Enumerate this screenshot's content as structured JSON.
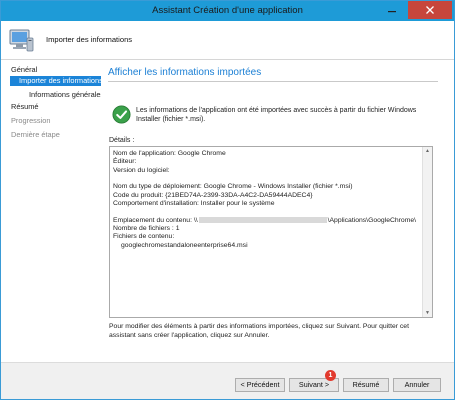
{
  "window": {
    "title": "Assistant Création d'une application"
  },
  "header": {
    "title": "Importer des informations"
  },
  "sidebar": {
    "items": [
      {
        "label": "Général"
      },
      {
        "label": "Importer des informations"
      },
      {
        "label": "Informations générales"
      },
      {
        "label": "Résumé"
      },
      {
        "label": "Progression"
      },
      {
        "label": "Dernière étape"
      }
    ]
  },
  "main": {
    "title": "Afficher les informations importées",
    "info_text": "Les informations de l'application ont été importées avec succès à partir du fichier Windows Installer (fichier *.msi).",
    "details_label": "Détails :",
    "details": {
      "line1": "Nom de l'application: Google Chrome",
      "line2": "Éditeur:",
      "line3": "Version du logiciel:",
      "line4": "Nom du type de déploiement: Google Chrome - Windows Installer (fichier *.msi)",
      "line5": "Code du produit: {21BED74A-2399-33DA-A4C2-DA59444ADEC4}",
      "line6": "Comportement d'installation: Installer pour le système",
      "line7_prefix": "Emplacement du contenu: \\\\",
      "line7_suffix": "\\Applications\\GoogleChrome\\",
      "line8": "Nombre de fichiers : 1",
      "line9": "Fichiers de contenu:",
      "line10": "googlechromestandaloneenterprise64.msi"
    },
    "footer_text": "Pour modifier des éléments à partir des informations importées, cliquez sur Suivant. Pour quitter cet assistant sans créer l'application, cliquez sur Annuler."
  },
  "buttons": {
    "previous": "< Précédent",
    "next": "Suivant >",
    "summary": "Résumé",
    "cancel": "Annuler",
    "badge": "1"
  },
  "colors": {
    "accent": "#1b84d8",
    "titlebar": "#1e9bd7",
    "close": "#c7463c",
    "badge": "#e23a2e"
  }
}
